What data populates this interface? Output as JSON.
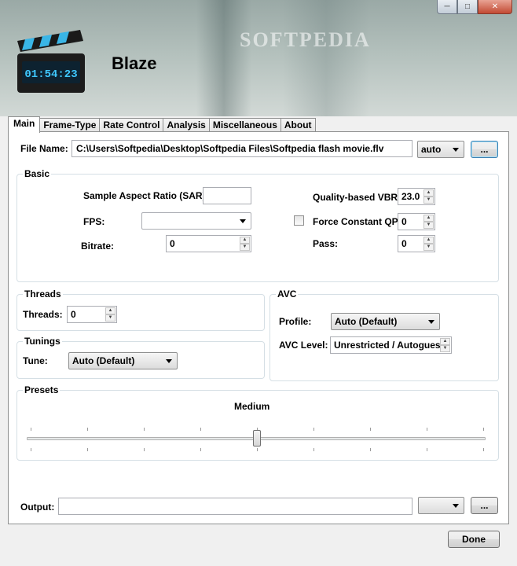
{
  "app": {
    "title": "Blaze",
    "logo_clock": "01:54:23",
    "watermark": "SOFTPEDIA"
  },
  "window_controls": {
    "minimize_icon": "minimize-icon",
    "maximize_icon": "maximize-icon",
    "close_icon": "close-icon"
  },
  "tabs": [
    {
      "label": "Main",
      "active": true
    },
    {
      "label": "Frame-Type",
      "active": false
    },
    {
      "label": "Rate Control",
      "active": false
    },
    {
      "label": "Analysis",
      "active": false
    },
    {
      "label": "Miscellaneous",
      "active": false
    },
    {
      "label": "About",
      "active": false
    }
  ],
  "file": {
    "label": "File Name:",
    "value": "C:\\Users\\Softpedia\\Desktop\\Softpedia Files\\Softpedia flash movie.flv",
    "format_select": "auto",
    "browse_label": "..."
  },
  "basic": {
    "title": "Basic",
    "sar_label": "Sample Aspect Ratio (SAR):",
    "sar_value": "",
    "fps_label": "FPS:",
    "fps_value": "",
    "bitrate_label": "Bitrate:",
    "bitrate_value": "0",
    "vbr_label": "Quality-based VBR:",
    "vbr_value": "23.0",
    "force_qp_label": "Force Constant QP:",
    "force_qp_checked": false,
    "force_qp_value": "0",
    "pass_label": "Pass:",
    "pass_value": "0"
  },
  "threads": {
    "title": "Threads",
    "label": "Threads:",
    "value": "0"
  },
  "tunings": {
    "title": "Tunings",
    "tune_label": "Tune:",
    "tune_value": "Auto (Default)"
  },
  "avc": {
    "title": "AVC",
    "profile_label": "Profile:",
    "profile_value": "Auto (Default)",
    "level_label": "AVC Level:",
    "level_value": "Unrestricted / Autoguess"
  },
  "presets": {
    "title": "Presets",
    "current": "Medium",
    "slider_position": 0.5
  },
  "output": {
    "label": "Output:",
    "value": "",
    "format_select": "",
    "browse_label": "..."
  },
  "done_label": "Done",
  "colors": {
    "panel_bg": "#ffffff",
    "window_bg": "#f0f0f0",
    "group_border": "#d5dfe5",
    "close_button": "#c24a33"
  }
}
